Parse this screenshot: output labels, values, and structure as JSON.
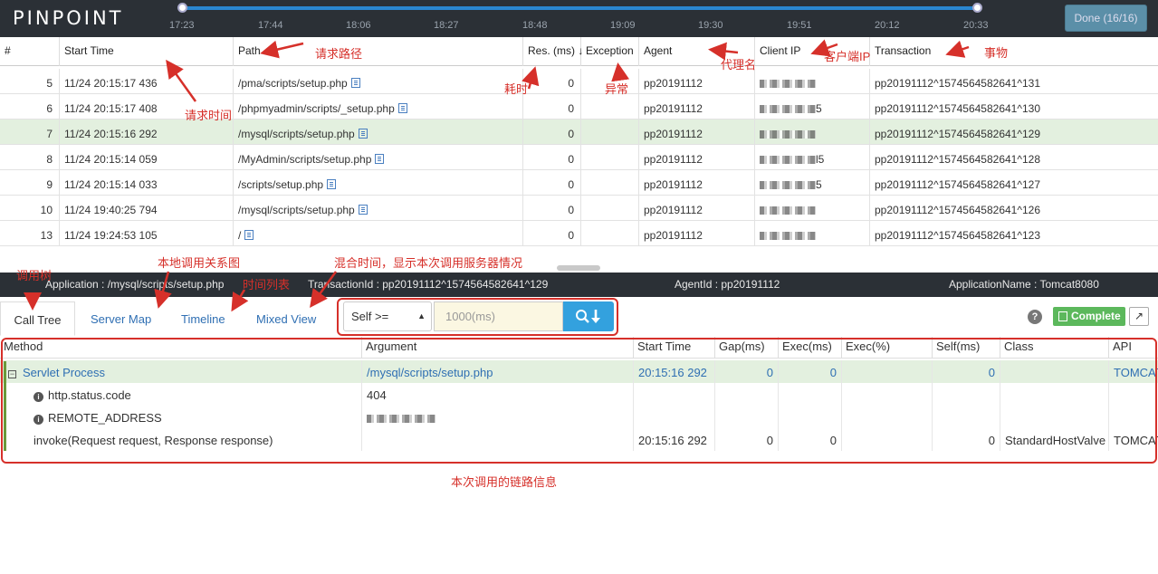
{
  "app": {
    "logo": "PINPOINT",
    "done_button": "Done (16/16)"
  },
  "timeline": {
    "ticks": [
      "17:23",
      "17:44",
      "18:06",
      "18:27",
      "18:48",
      "19:09",
      "19:30",
      "19:51",
      "20:12",
      "20:33"
    ]
  },
  "transactions": {
    "columns": [
      "#",
      "Start Time",
      "Path",
      "Res. (ms)",
      "Exception",
      "Agent",
      "Client IP",
      "Transaction"
    ],
    "sort_indicator": "↓",
    "rows": [
      {
        "no": "5",
        "start": "11/24 20:15:17 436",
        "path": "/pma/scripts/setup.php",
        "res": "0",
        "exception": "",
        "agent": "pp20191112",
        "ip_suffix": "",
        "tx": "pp20191112^1574564582641^131",
        "selected": false
      },
      {
        "no": "6",
        "start": "11/24 20:15:17 408",
        "path": "/phpmyadmin/scripts/_setup.php",
        "res": "0",
        "exception": "",
        "agent": "pp20191112",
        "ip_suffix": "5",
        "tx": "pp20191112^1574564582641^130",
        "selected": false
      },
      {
        "no": "7",
        "start": "11/24 20:15:16 292",
        "path": "/mysql/scripts/setup.php",
        "res": "0",
        "exception": "",
        "agent": "pp20191112",
        "ip_suffix": "",
        "tx": "pp20191112^1574564582641^129",
        "selected": true
      },
      {
        "no": "8",
        "start": "11/24 20:15:14 059",
        "path": "/MyAdmin/scripts/setup.php",
        "res": "0",
        "exception": "",
        "agent": "pp20191112",
        "ip_suffix": "l5",
        "tx": "pp20191112^1574564582641^128",
        "selected": false
      },
      {
        "no": "9",
        "start": "11/24 20:15:14 033",
        "path": "/scripts/setup.php",
        "res": "0",
        "exception": "",
        "agent": "pp20191112",
        "ip_suffix": "5",
        "tx": "pp20191112^1574564582641^127",
        "selected": false
      },
      {
        "no": "10",
        "start": "11/24 19:40:25 794",
        "path": "/mysql/scripts/setup.php",
        "res": "0",
        "exception": "",
        "agent": "pp20191112",
        "ip_suffix": "",
        "tx": "pp20191112^1574564582641^126",
        "selected": false
      },
      {
        "no": "13",
        "start": "11/24 19:24:53 105",
        "path": "/",
        "res": "0",
        "exception": "",
        "agent": "pp20191112",
        "ip_suffix": "",
        "tx": "pp20191112^1574564582641^123",
        "selected": false
      }
    ]
  },
  "info_bar": {
    "application": "Application : /mysql/scripts/setup.php",
    "transaction_id": "TransactionId : pp20191112^1574564582641^129",
    "agent_id": "AgentId : pp20191112",
    "application_name": "ApplicationName : Tomcat8080"
  },
  "tabs": [
    "Call Tree",
    "Server Map",
    "Timeline",
    "Mixed View"
  ],
  "filter": {
    "select_value": "Self >=",
    "threshold_placeholder": "1000(ms)"
  },
  "toolbar": {
    "help": "?",
    "complete": "Complete"
  },
  "call_tree": {
    "columns": [
      "Method",
      "Argument",
      "Start Time",
      "Gap(ms)",
      "Exec(ms)",
      "Exec(%)",
      "Self(ms)",
      "Class",
      "API"
    ],
    "rows": [
      {
        "method": "Servlet Process",
        "argument": "/mysql/scripts/setup.php",
        "start": "20:15:16 292",
        "gap": "0",
        "exec": "0",
        "exec_pct": "",
        "self": "0",
        "class": "",
        "api": "TOMCAT"
      },
      {
        "method": "http.status.code",
        "argument": "404",
        "start": "",
        "gap": "",
        "exec": "",
        "exec_pct": "",
        "self": "",
        "class": "",
        "api": ""
      },
      {
        "method": "REMOTE_ADDRESS",
        "argument": "",
        "start": "",
        "gap": "",
        "exec": "",
        "exec_pct": "",
        "self": "",
        "class": "",
        "api": ""
      },
      {
        "method": "invoke(Request request, Response response)",
        "argument": "",
        "start": "20:15:16 292",
        "gap": "0",
        "exec": "0",
        "exec_pct": "",
        "self": "0",
        "class": "StandardHostValve",
        "api": "TOMCAT"
      }
    ]
  },
  "annotations": {
    "path": "请求路径",
    "start_time": "请求时间",
    "response_time": "耗时",
    "exception": "异常",
    "agent": "代理名",
    "client_ip": "客户端IP",
    "transaction": "事物",
    "call_tree": "调用树",
    "server_map": "本地调用关系图",
    "timeline": "时间列表",
    "mixed_view": "混合时间，显示本次调用服务器情况",
    "call_chain": "本次调用的链路信息"
  },
  "colors": {
    "topbar": "#2b3036",
    "selected_row": "#e3f0df",
    "link": "#2f6fb3",
    "annotation": "#d6302a",
    "complete_button": "#5cb85c",
    "search_button": "#33a1de"
  }
}
